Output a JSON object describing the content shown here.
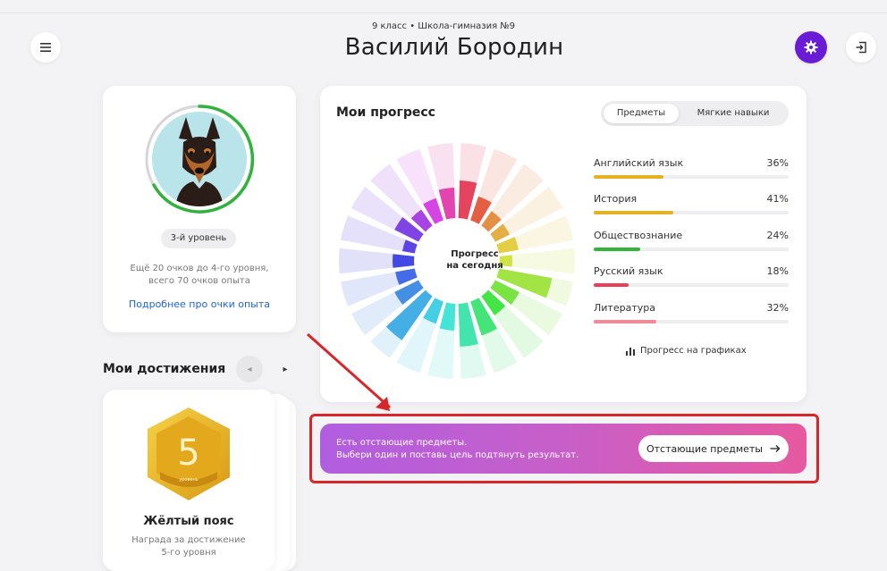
{
  "header": {
    "subtitle": "9 класс • Школа-гимназия №9",
    "name": "Василий Бородин",
    "menu_icon": "hamburger-icon",
    "settings_icon": "gear-icon",
    "logout_icon": "logout-icon"
  },
  "profile": {
    "level": "3-й уровень",
    "level_desc_line1": "Ещё 20 очков до 4-го уровня,",
    "level_desc_line2": "всего 70 очков опыта",
    "details_link": "Подробнее про очки опыта",
    "level_ring_progress": 0.7
  },
  "achievements": {
    "title": "Мои достижения",
    "badge_number": "5",
    "badge_ribbon": "уровень",
    "name": "Жёлтый пояс",
    "desc_line1": "Награда за достижение",
    "desc_line2": "5-го уровня"
  },
  "progress": {
    "title": "Мои прогресс",
    "tabs": [
      "Предметы",
      "Мягкие навыки"
    ],
    "wheel_label_line1": "Прогресс",
    "wheel_label_line2": "на сегодня",
    "subjects": [
      {
        "name": "Английский язык",
        "percent": "36%",
        "value": 0.36,
        "color": "#e5b321"
      },
      {
        "name": "История",
        "percent": "41%",
        "value": 0.41,
        "color": "#e5b321"
      },
      {
        "name": "Обществознание",
        "percent": "24%",
        "value": 0.24,
        "color": "#33b538"
      },
      {
        "name": "Русский язык",
        "percent": "18%",
        "value": 0.18,
        "color": "#ec3c57"
      },
      {
        "name": "Литература",
        "percent": "32%",
        "value": 0.32,
        "color": "#f08a96"
      }
    ],
    "graphs_link": "Прогресс на графиках"
  },
  "banner": {
    "line1": "Есть отстающие предметы.",
    "line2": "Выбери один и поставь цель подтянуть результат.",
    "button": "Отстающие предметы"
  },
  "colors": {
    "accent": "#6a1bd6",
    "link": "#1f63d8",
    "highlight": "#d9262b"
  }
}
